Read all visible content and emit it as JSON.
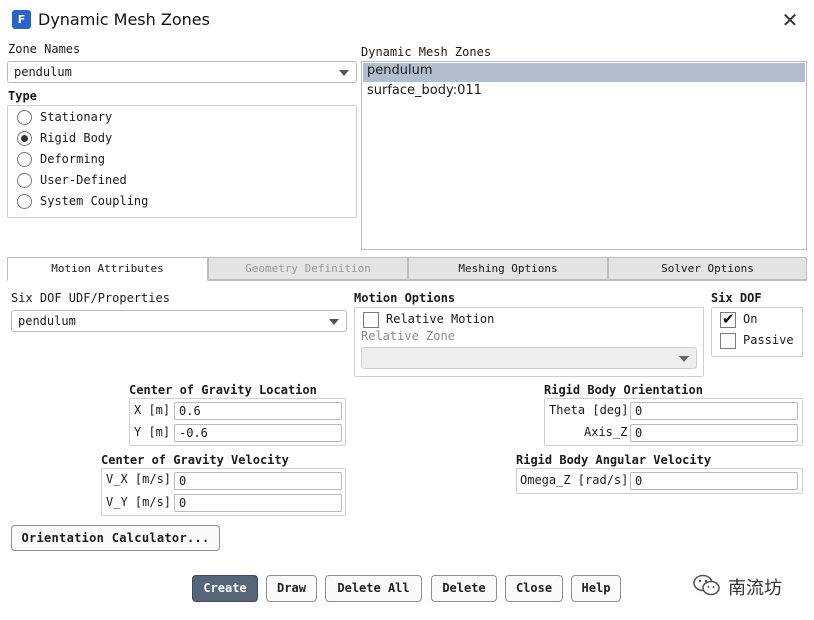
{
  "window": {
    "icon_letter": "F",
    "title": "Dynamic Mesh Zones",
    "close_glyph": "✕"
  },
  "zone_names": {
    "label": "Zone Names",
    "value": "pendulum"
  },
  "type": {
    "label": "Type",
    "options": [
      "Stationary",
      "Rigid Body",
      "Deforming",
      "User-Defined",
      "System Coupling"
    ],
    "selected": "Rigid Body"
  },
  "dynamic_mesh_zones": {
    "label": "Dynamic Mesh Zones",
    "items": [
      "pendulum",
      "surface_body:011"
    ],
    "selected": "pendulum"
  },
  "tabs": [
    {
      "label": "Motion Attributes",
      "active": true
    },
    {
      "label": "Geometry Definition",
      "active": false
    },
    {
      "label": "Meshing Options",
      "active": false
    },
    {
      "label": "Solver Options",
      "active": false
    }
  ],
  "six_dof_udf": {
    "label": "Six DOF UDF/Properties",
    "value": "pendulum"
  },
  "motion_options": {
    "label": "Motion Options",
    "relative_motion_label": "Relative Motion",
    "relative_motion_checked": false,
    "relative_zone_label": "Relative Zone",
    "relative_zone_value": ""
  },
  "six_dof": {
    "label": "Six DOF",
    "on_label": "On",
    "on_checked": true,
    "passive_label": "Passive",
    "passive_checked": false
  },
  "cg_location": {
    "label": "Center of Gravity Location",
    "x_label": "X [m]",
    "x_value": "0.6",
    "y_label": "Y [m]",
    "y_value": "-0.6"
  },
  "cg_velocity": {
    "label": "Center of Gravity Velocity",
    "vx_label": "V_X [m/s]",
    "vx_value": "0",
    "vy_label": "V_Y [m/s]",
    "vy_value": "0"
  },
  "orientation": {
    "label": "Rigid Body Orientation",
    "theta_label": "Theta [deg]",
    "theta_value": "0",
    "axis_label": "Axis_Z",
    "axis_value": "0"
  },
  "angular_velocity": {
    "label": "Rigid Body Angular Velocity",
    "omega_label": "Omega_Z [rad/s]",
    "omega_value": "0"
  },
  "orientation_calculator_label": "Orientation Calculator...",
  "buttons": {
    "create": "Create",
    "draw": "Draw",
    "delete_all": "Delete All",
    "delete": "Delete",
    "close": "Close",
    "help": "Help"
  },
  "watermark": {
    "text": "南流坊"
  }
}
